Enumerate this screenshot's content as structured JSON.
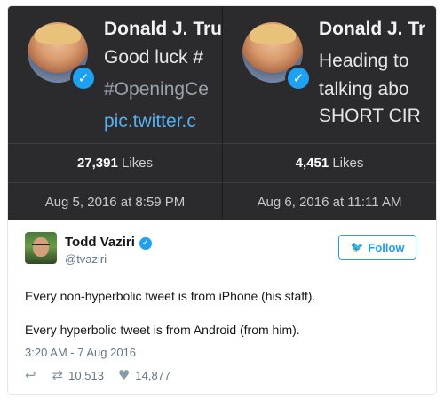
{
  "screenshots": [
    {
      "name": "Donald J. Tru",
      "lines": [
        "Good luck #",
        "#OpeningCe",
        "pic.twitter.c"
      ],
      "likes_count": "27,391",
      "likes_label": "Likes",
      "date": "Aug 5, 2016 at 8:59 PM"
    },
    {
      "name": "Donald J. Tr",
      "lines": [
        "Heading to",
        "talking abo",
        "SHORT CIR"
      ],
      "likes_count": "4,451",
      "likes_label": "Likes",
      "date": "Aug 6, 2016 at 11:11 AM"
    }
  ],
  "tweet": {
    "name": "Todd Vaziri",
    "handle": "@tvaziri",
    "follow_label": "Follow",
    "text_line1": "Every non-hyperbolic tweet is from iPhone (his staff).",
    "text_line2": "Every hyperbolic tweet is from Android (from him).",
    "timestamp": "3:20 AM - 7 Aug 2016",
    "retweets": "10,513",
    "likes": "14,877"
  },
  "icons": {
    "verified": "verified-check-icon",
    "follow": "twitter-bird-icon",
    "reply": "reply-icon",
    "retweet": "retweet-icon",
    "like": "heart-icon"
  },
  "colors": {
    "accent": "#1da1f2",
    "screenshot_bg": "#2b2b2d",
    "link": "#55b0ee"
  }
}
